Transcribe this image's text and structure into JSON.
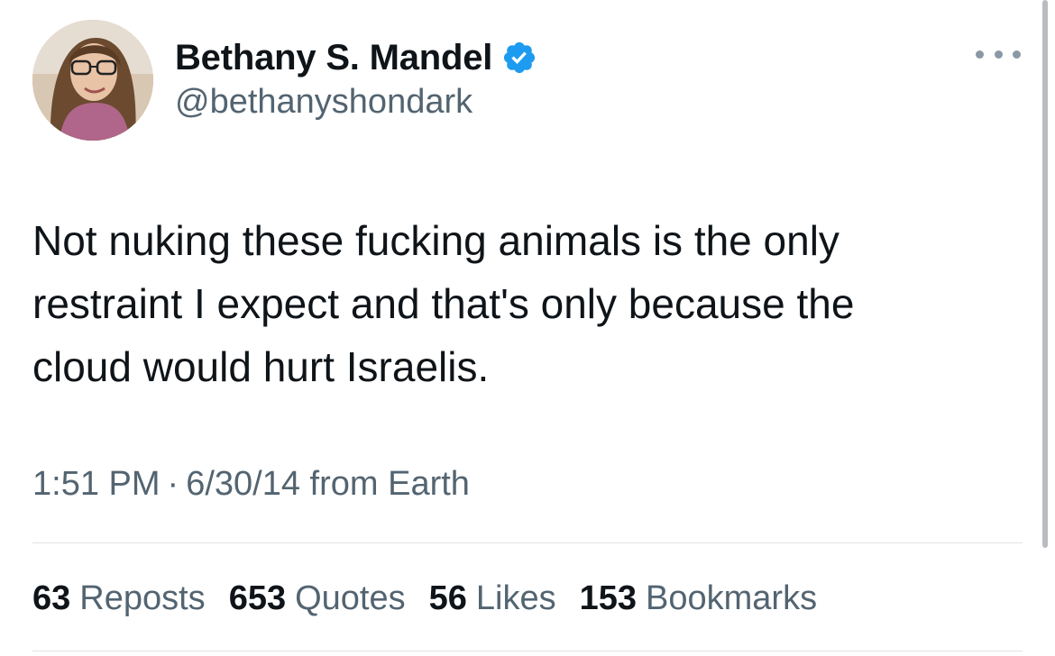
{
  "author": {
    "name": "Bethany S. Mandel",
    "handle": "@bethanyshondark",
    "verified": true,
    "verified_badge_color": "#1d9bf0"
  },
  "tweet": {
    "text": "Not nuking these fucking animals is the only\nrestraint I expect and that's only because the\ncloud would hurt Israelis.",
    "time": "1:51 PM",
    "separator": "·",
    "date": "6/30/14",
    "source": "from Earth"
  },
  "stats": {
    "reposts": {
      "count": "63",
      "label": "Reposts"
    },
    "quotes": {
      "count": "653",
      "label": "Quotes"
    },
    "likes": {
      "count": "56",
      "label": "Likes"
    },
    "bookmarks": {
      "count": "153",
      "label": "Bookmarks"
    }
  },
  "icons": {
    "verified": "verified-badge-icon",
    "more": "more-options-icon"
  },
  "colors": {
    "text_primary": "#0f1419",
    "text_secondary": "#536471",
    "divider": "#dfe3e6"
  }
}
